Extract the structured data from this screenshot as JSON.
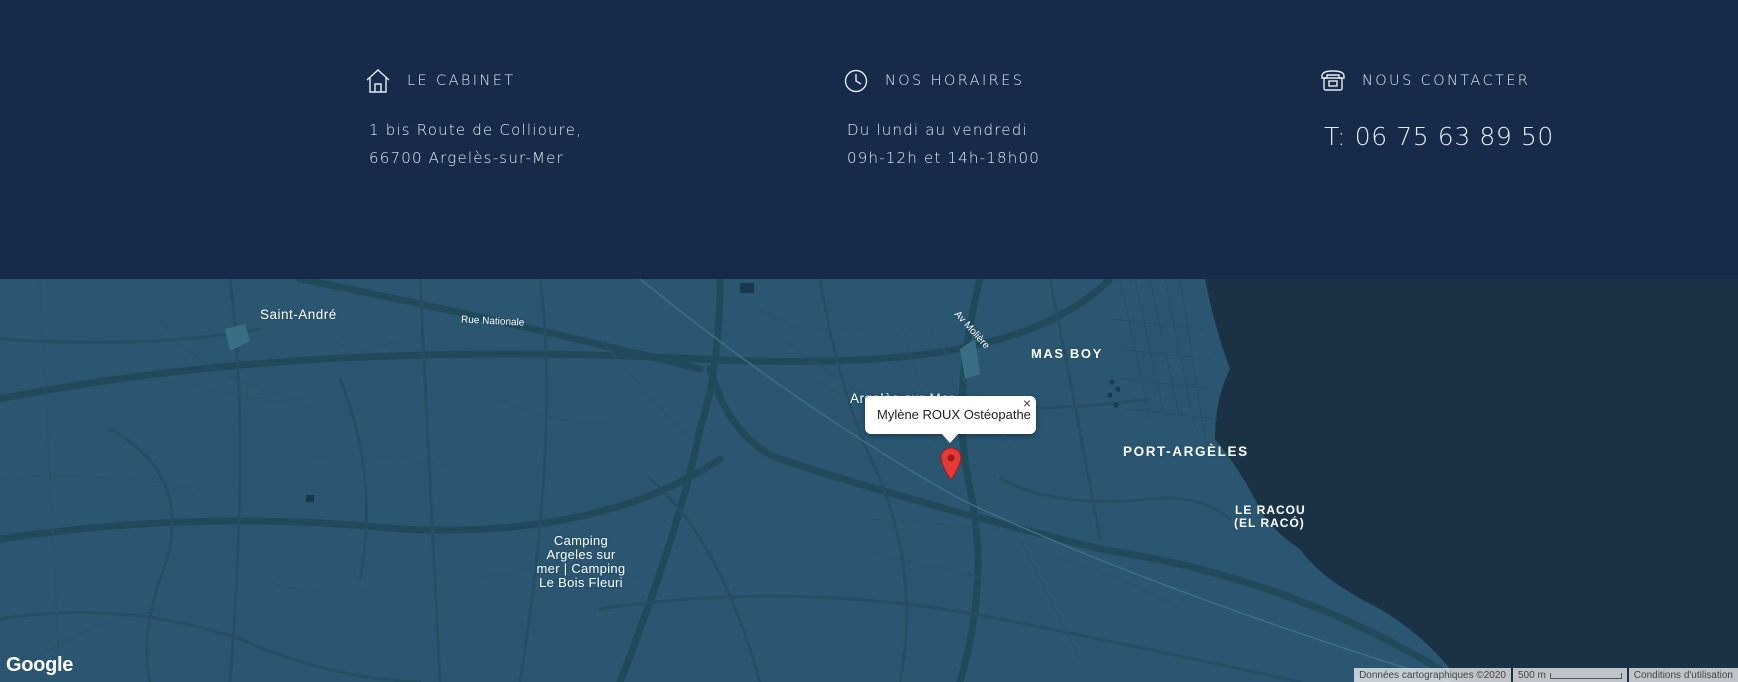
{
  "cabinet": {
    "icon": "house-icon",
    "title": "LE CABINET",
    "address_line1": "1 bis Route de Collioure,",
    "address_line2": "66700 Argelès-sur-Mer"
  },
  "horaires": {
    "icon": "clock-icon",
    "title": "NOS HORAIRES",
    "line1": "Du lundi au vendredi",
    "line2": "09h-12h et 14h-18h00"
  },
  "contact": {
    "icon": "phone-icon",
    "title": "NOUS CONTACTER",
    "phone": "T: 06 75 63 89 50"
  },
  "map": {
    "places": {
      "saint_andre": "Saint-André",
      "rue_nationale": "Rue Nationale",
      "av_moliere": "Av Molière",
      "mas_boy": "MAS BOY",
      "argeles": "Argelès-sur-Mer",
      "port_argeles": "PORT-ARGÈLES",
      "le_racou_1": "LE RACOU",
      "le_racou_2": "(EL RACÓ)",
      "camping_1": "Camping",
      "camping_2": "Argeles sur",
      "camping_3": "mer | Camping",
      "camping_4": "Le Bois Fleuri"
    },
    "infowindow_text": "Mylène ROUX Ostéopathe",
    "close_symbol": "×",
    "logo": "Google",
    "attribution": "Données cartographiques ©2020",
    "scale": "500 m",
    "terms": "Conditions d'utilisation",
    "colors": {
      "land": "#2a5672",
      "roads": "#1f4a5a",
      "sea": "#1b3244",
      "pin": "#e53935"
    }
  }
}
